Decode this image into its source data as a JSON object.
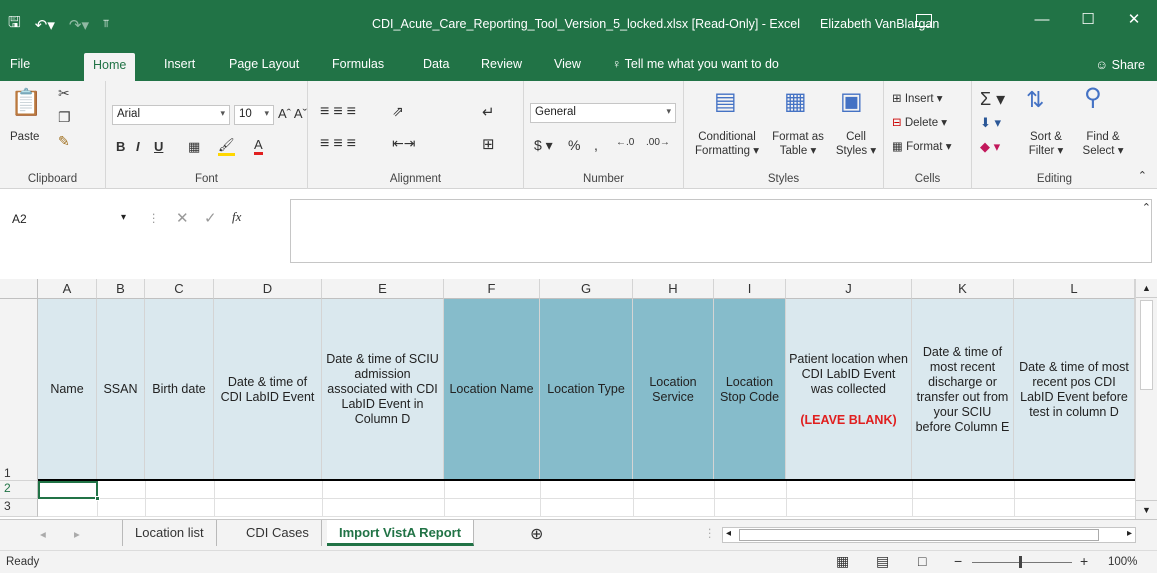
{
  "titlebar": {
    "title": "CDI_Acute_Care_Reporting_Tool_Version_5_locked.xlsx  [Read-Only]  -  Excel",
    "user": "Elizabeth VanBlargan"
  },
  "menu": {
    "tabs": [
      "File",
      "Home",
      "Insert",
      "Page Layout",
      "Formulas",
      "Data",
      "Review",
      "View"
    ],
    "tell_me": "Tell me what you want to do",
    "share": "Share"
  },
  "ribbon": {
    "clipboard": {
      "paste": "Paste",
      "label": "Clipboard"
    },
    "font": {
      "name": "Arial",
      "size": "10",
      "label": "Font"
    },
    "alignment": {
      "label": "Alignment"
    },
    "number": {
      "format": "General",
      "label": "Number"
    },
    "styles": {
      "conditional": "Conditional",
      "formatting": "Formatting",
      "format_as": "Format as",
      "table": "Table",
      "cell": "Cell",
      "cell_styles": "Styles",
      "label": "Styles"
    },
    "cells": {
      "insert": "Insert",
      "delete": "Delete",
      "format": "Format",
      "label": "Cells"
    },
    "editing": {
      "sort": "Sort &",
      "filter": "Filter",
      "find": "Find &",
      "select": "Select",
      "label": "Editing"
    }
  },
  "formula_bar": {
    "name_box": "A2",
    "fx": "fx",
    "value": ""
  },
  "grid": {
    "columns": [
      "A",
      "B",
      "C",
      "D",
      "E",
      "F",
      "G",
      "H",
      "I",
      "J",
      "K",
      "L"
    ],
    "rows": [
      "1",
      "2",
      "3"
    ],
    "headers": {
      "A": "Name",
      "B": "SSAN",
      "C": "Birth date",
      "D": "Date & time of CDI LabID Event",
      "E": "Date & time of SCIU admission associated with CDI LabID Event in Column D",
      "F": "Location Name",
      "G": "Location Type",
      "H": "Location Service",
      "I": "Location Stop Code",
      "J": "Patient location when CDI LabID Event was collected",
      "J_note": "(LEAVE BLANK)",
      "K": "Date & time of most recent discharge or transfer out from your SCIU before Column E",
      "L": "Date & time of most recent pos CDI LabID Event before test in column D"
    }
  },
  "sheets": [
    "Location list",
    "CDI Cases",
    "Import VistA Report"
  ],
  "active_sheet": "Import VistA Report",
  "status": {
    "left": "Ready",
    "zoom": "100%"
  },
  "colors": {
    "excel_green": "#217346",
    "header_light": "#dae8ee",
    "header_teal": "#86bccb",
    "note_red": "#e01f1f"
  }
}
